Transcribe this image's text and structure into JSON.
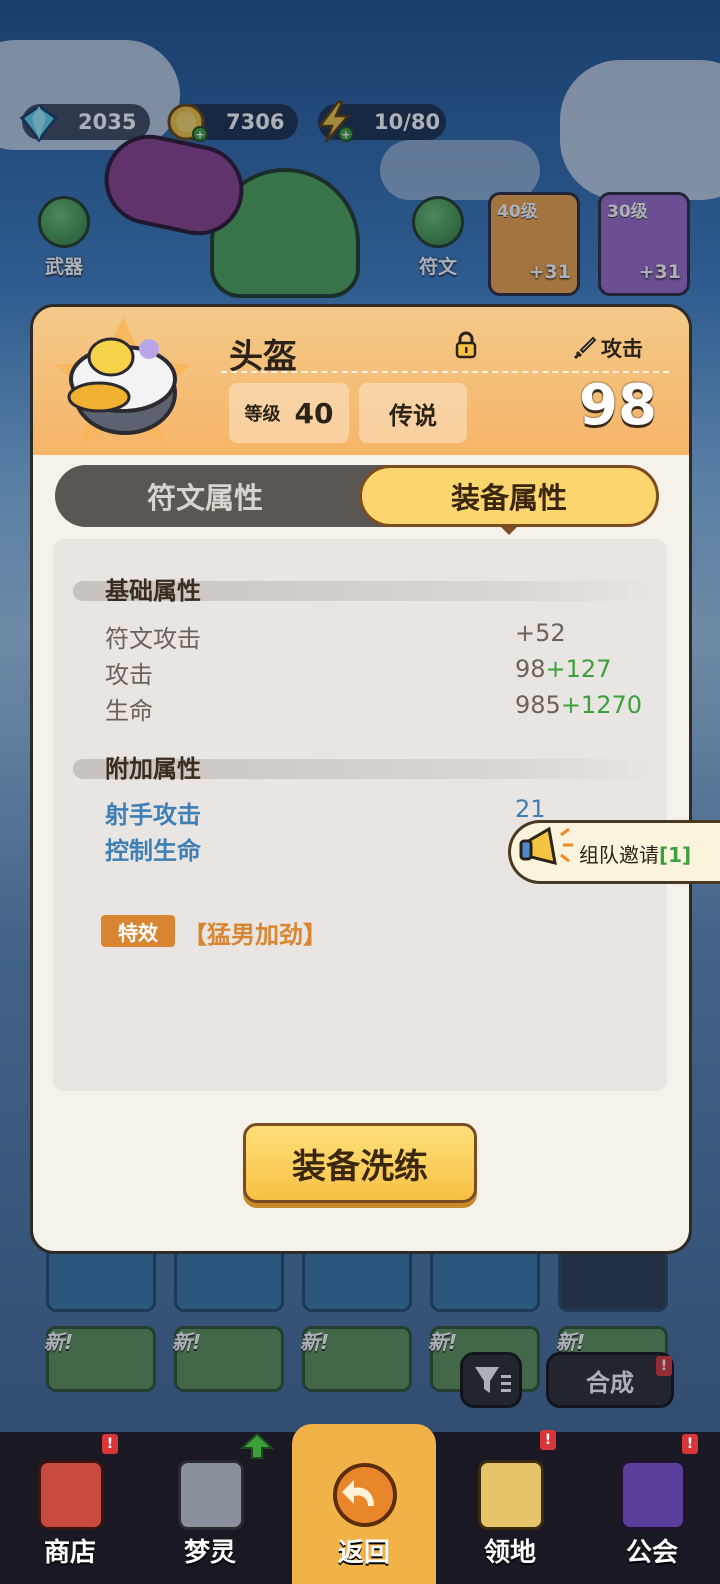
{
  "resources": [
    {
      "name": "gems",
      "icon": "gem-icon",
      "value": "2035"
    },
    {
      "name": "coins",
      "icon": "coin-icon",
      "value": "7306"
    },
    {
      "name": "energy",
      "icon": "lightning-icon",
      "value": "10/80"
    }
  ],
  "side": {
    "weapon_label": "武器",
    "rune_label": "符文"
  },
  "equipment_slots": [
    {
      "level": "40级",
      "plus": "+31"
    },
    {
      "level": "30级",
      "plus": "+31"
    }
  ],
  "popup": {
    "item_name": "头盔",
    "stat_type": "攻击",
    "level_label": "等级",
    "level_value": "40",
    "rarity": "传说",
    "power": "98",
    "tabs": [
      {
        "label": "符文属性",
        "active": false
      },
      {
        "label": "装备属性",
        "active": true
      }
    ],
    "base_section": {
      "title": "基础属性",
      "rows": [
        {
          "name": "符文攻击",
          "base": "+52",
          "bonus": ""
        },
        {
          "name": "攻击",
          "base": "98",
          "bonus": "+127"
        },
        {
          "name": "生命",
          "base": "985",
          "bonus": "+1270"
        }
      ]
    },
    "extra_section": {
      "title": "附加属性",
      "rows": [
        {
          "name": "射手攻击",
          "value": "21"
        },
        {
          "name": "控制生命",
          "value": ""
        }
      ]
    },
    "effect": {
      "badge": "特效",
      "name": "【猛男加劲】"
    },
    "refine_button": "装备洗练"
  },
  "team_invite": {
    "label": "组队邀请",
    "count": "[1]"
  },
  "grid_tags": [
    "新!",
    "新!",
    "新!",
    "新!",
    "新!"
  ],
  "merge_button": "合成",
  "nav": [
    {
      "label": "商店",
      "icon": "shop-icon",
      "badge": "!"
    },
    {
      "label": "梦灵",
      "icon": "spirit-icon",
      "badge": ""
    },
    {
      "label": "返回",
      "icon": "back-arrow-icon",
      "badge": ""
    },
    {
      "label": "领地",
      "icon": "territory-icon",
      "badge": "!"
    },
    {
      "label": "公会",
      "icon": "guild-icon",
      "badge": "!"
    }
  ],
  "colors": {
    "header_orange": "#f6b568",
    "tab_active": "#fbd56e",
    "bonus_green": "#3ca13c",
    "extra_blue": "#3f7fb5",
    "effect_orange": "#d98632"
  }
}
